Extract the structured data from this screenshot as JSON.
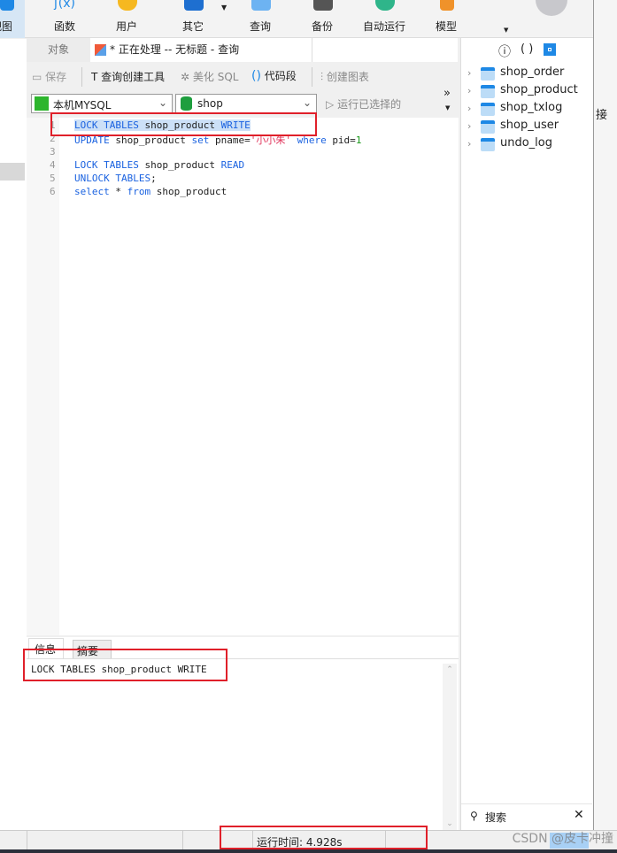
{
  "toolbar": {
    "items": [
      {
        "label": "视图",
        "icon": "view-icon"
      },
      {
        "label": "函数",
        "icon": "function-icon"
      },
      {
        "label": "用户",
        "icon": "user-icon"
      },
      {
        "label": "其它",
        "icon": "other-icon"
      },
      {
        "label": "查询",
        "icon": "query-icon"
      },
      {
        "label": "备份",
        "icon": "backup-icon"
      },
      {
        "label": "自动运行",
        "icon": "schedule-icon"
      },
      {
        "label": "模型",
        "icon": "model-icon"
      }
    ]
  },
  "tabs": {
    "objects": "对象",
    "active": "* 正在处理 -- 无标题 - 查询"
  },
  "query_toolbar": {
    "save": "保存",
    "query_builder": "查询创建工具",
    "beautify": "美化 SQL",
    "snippet": "代码段",
    "create_chart": "创建图表",
    "run_selected": "运行已选择的",
    "more": "»"
  },
  "connection": {
    "value": "本机MYSQL",
    "color": "#2db52d"
  },
  "database": {
    "value": "shop"
  },
  "editor": {
    "lines": [
      {
        "n": "1",
        "parts": [
          [
            "kw",
            "LOCK TABLES "
          ],
          [
            "",
            "shop_product "
          ],
          [
            "kw",
            "WRITE"
          ]
        ]
      },
      {
        "n": "2",
        "parts": [
          [
            "kw",
            "UPDATE "
          ],
          [
            "",
            "shop_product "
          ],
          [
            "kw",
            "set "
          ],
          [
            "",
            "pname="
          ],
          [
            "str",
            "'小小朱'"
          ],
          [
            "kw",
            " where "
          ],
          [
            "",
            "pid="
          ],
          [
            "num",
            "1"
          ]
        ]
      },
      {
        "n": "3",
        "parts": []
      },
      {
        "n": "4",
        "parts": [
          [
            "kw",
            "LOCK TABLES "
          ],
          [
            "",
            "shop_product "
          ],
          [
            "kw",
            "READ"
          ]
        ]
      },
      {
        "n": "5",
        "parts": [
          [
            "kw",
            "UNLOCK TABLES"
          ],
          [
            "",
            ";"
          ]
        ]
      },
      {
        "n": "6",
        "parts": [
          [
            "kw",
            "select "
          ],
          [
            "",
            "* "
          ],
          [
            "kw",
            "from "
          ],
          [
            "",
            "shop_product"
          ]
        ]
      }
    ]
  },
  "result": {
    "tabs": [
      "信息",
      "摘要"
    ],
    "message": "LOCK TABLES shop_product WRITE"
  },
  "right_panel": {
    "tables": [
      "shop_order",
      "shop_product",
      "shop_txlog",
      "shop_user",
      "undo_log"
    ],
    "search_placeholder": "搜索",
    "edge_text": "接"
  },
  "status": {
    "run_time": "运行时间: 4.928s"
  },
  "watermark": "CSDN @皮卡冲撞",
  "colors": {
    "highlight": "#e0202a",
    "keyword": "#1a62e0",
    "selection": "#cce0f7"
  }
}
